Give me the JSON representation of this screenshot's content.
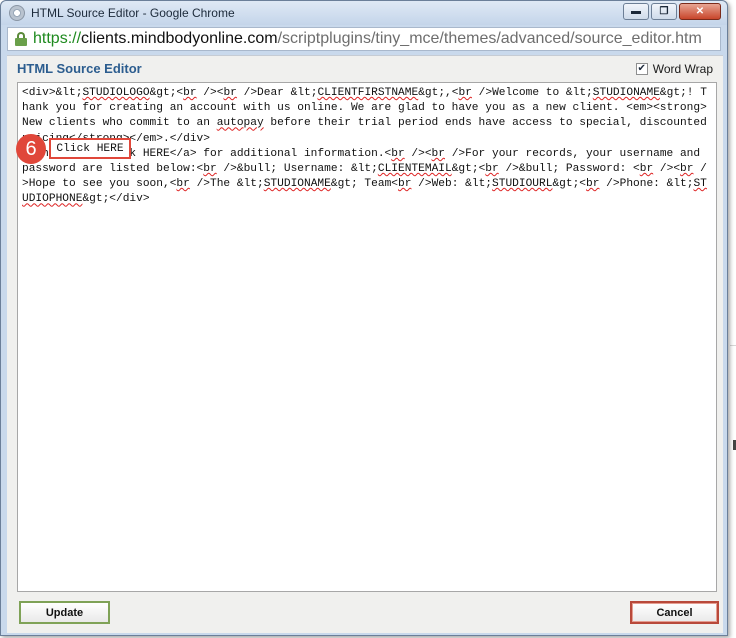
{
  "window": {
    "title": "HTML Source Editor - Google Chrome",
    "controls": {
      "minimize": "▬",
      "maximize": "❐",
      "close": "✕"
    }
  },
  "address_bar": {
    "scheme": "https://",
    "host": "clients.mindbodyonline.com",
    "path": "/scriptplugins/tiny_mce/themes/advanced/source_editor.htm"
  },
  "editor": {
    "title": "HTML Source Editor",
    "word_wrap_label": "Word Wrap",
    "word_wrap_checked": true,
    "word_wrap_mark": "✔",
    "source_segments": [
      "<div>&lt;",
      "STUDIOLOGO",
      "&gt;<",
      "br",
      " /><",
      "br",
      " />Dear &lt;",
      "CLIENTFIRSTNAME",
      "&gt;,<",
      "br",
      " />Welcome to &lt;",
      "STUDIONAME",
      "&gt;! Thank you for creating an account with us online. We are glad to have you as a new client. <em><strong>New clients who commit to an ",
      "autopay",
      " before their trial period ends have access to special, discounted pricing</strong></em>.</div>\n<a href=\"#\">Click HERE</a> for additional information.<",
      "br",
      " /><",
      "br",
      " />For your records, your username and password are listed below:<",
      "br",
      " />&bull; Username: &lt;",
      "CLIENTEMAIL",
      "&gt;<",
      "br",
      " />&bull; Password: <",
      "br",
      " /><",
      "br",
      " />Hope to see you soon,<",
      "br",
      " />The &lt;",
      "STUDIONAME",
      "&gt; Team<",
      "br",
      " />Web: &lt;",
      "STUDIOURL",
      "&gt;<",
      "br",
      " />Phone: &lt;",
      "STUDIOPHONE",
      "&gt;</div>"
    ]
  },
  "callout": {
    "number": "6",
    "label": "Click HERE"
  },
  "buttons": {
    "update": "Update",
    "cancel": "Cancel"
  },
  "colors": {
    "accent_title": "#2c5d8f",
    "callout_red": "#e0473a",
    "update_border": "#7fa257",
    "cancel_border": "#b8493a",
    "url_scheme_green": "#1e8a1e"
  }
}
